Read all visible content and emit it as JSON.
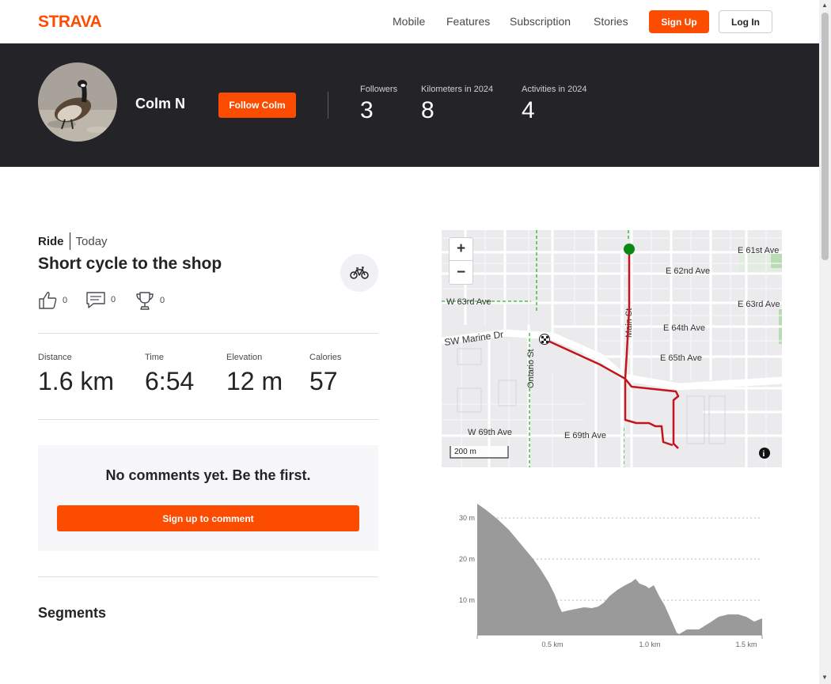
{
  "nav": {
    "logo_text": "STRAVA",
    "links": [
      "Mobile",
      "Features",
      "Subscription",
      "Stories"
    ],
    "signup_label": "Sign Up",
    "login_label": "Log In"
  },
  "athlete": {
    "name": "Colm N",
    "follow_label": "Follow Colm",
    "stats": [
      {
        "label": "Followers",
        "value": "3"
      },
      {
        "label": "Kilometers in 2024",
        "value": "8"
      },
      {
        "label": "Activities in 2024",
        "value": "4"
      }
    ]
  },
  "activity": {
    "type": "Ride",
    "date": "Today",
    "title": "Short cycle to the shop",
    "kudos": "0",
    "comments": "0",
    "achievements": "0",
    "metrics": [
      {
        "label": "Distance",
        "value": "1.6 km"
      },
      {
        "label": "Time",
        "value": "6:54"
      },
      {
        "label": "Elevation",
        "value": "12 m"
      },
      {
        "label": "Calories",
        "value": "57"
      }
    ]
  },
  "comments": {
    "empty_text": "No comments yet. Be the first.",
    "signup_label": "Sign up to comment"
  },
  "segments_heading": "Segments",
  "map": {
    "zoom_in": "+",
    "zoom_out": "−",
    "scale_label": "200 m",
    "streets": {
      "e61st": "E 61st Ave",
      "e62nd": "E 62nd Ave",
      "w63rd": "W 63rd Ave",
      "e63rd": "E 63rd Ave",
      "e64th": "E 64th Ave",
      "e65th": "E 65th Ave",
      "marine": "SW Marine Dr",
      "ontario": "Ontario St",
      "main": "Main St",
      "w69th": "W 69th Ave",
      "e69th": "E 69th Ave"
    },
    "start_color": "#0a8a14",
    "route_color": "#c4141c"
  },
  "elevation_chart": {
    "y_ticks": [
      "30 m",
      "20 m",
      "10 m"
    ],
    "x_ticks": [
      "0.5 km",
      "1.0 km",
      "1.5 km"
    ],
    "fill_color": "#9a9a9a"
  }
}
